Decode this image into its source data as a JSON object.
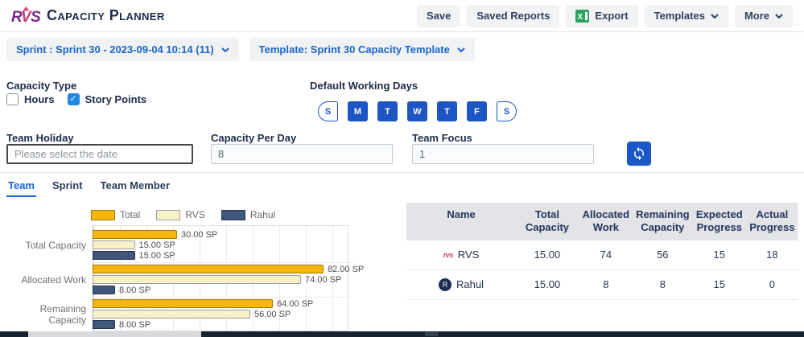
{
  "header": {
    "logo_text": "RVS",
    "title": "Capacity Planner"
  },
  "toolbar": {
    "save": "Save",
    "saved_reports": "Saved Reports",
    "export": "Export",
    "templates": "Templates",
    "more": "More"
  },
  "filters": {
    "sprint_selector": "Sprint : Sprint 30 - 2023-09-04 10:14 (11)",
    "template_selector": "Template: Sprint 30 Capacity Template"
  },
  "capacity_type": {
    "label": "Capacity Type",
    "options": [
      {
        "label": "Hours",
        "checked": false
      },
      {
        "label": "Story Points",
        "checked": true
      }
    ]
  },
  "working_days": {
    "label": "Default Working Days",
    "days": [
      {
        "label": "S",
        "active": false
      },
      {
        "label": "M",
        "active": true
      },
      {
        "label": "T",
        "active": true
      },
      {
        "label": "W",
        "active": true
      },
      {
        "label": "T",
        "active": true
      },
      {
        "label": "F",
        "active": true
      },
      {
        "label": "S",
        "active": false
      }
    ]
  },
  "inputs": {
    "team_holiday": {
      "label": "Team Holiday",
      "placeholder": "Please select the date",
      "value": ""
    },
    "capacity_per_day": {
      "label": "Capacity Per Day",
      "value": "8"
    },
    "team_focus": {
      "label": "Team Focus",
      "value": "1"
    }
  },
  "tabs": [
    {
      "label": "Team",
      "active": true
    },
    {
      "label": "Sprint",
      "active": false
    },
    {
      "label": "Team Member",
      "active": false
    }
  ],
  "chart_data": {
    "type": "bar",
    "orientation": "horizontal",
    "unit": "SP",
    "categories": [
      "Total Capacity",
      "Allocated Work",
      "Remaining Capacity"
    ],
    "series": [
      {
        "name": "Total",
        "color": "#F5B60D",
        "border": "#9E7A06",
        "values": [
          30,
          82,
          64
        ],
        "labels": [
          "30.00 SP",
          "82.00 SP",
          "64.00 SP"
        ]
      },
      {
        "name": "RVS",
        "color": "#FAF1C6",
        "border": "#9AA0A6",
        "values": [
          15,
          74,
          56
        ],
        "labels": [
          "15.00 SP",
          "74.00 SP",
          "56.00 SP"
        ]
      },
      {
        "name": "Rahul",
        "color": "#40567B",
        "border": "#22334E",
        "values": [
          15,
          8,
          8
        ],
        "labels": [
          "15.00 SP",
          "8.00 SP",
          "8.00 SP"
        ]
      }
    ],
    "xlim": [
      0,
      90
    ],
    "gridline_interval": 10,
    "grid": true,
    "legend_position": "top"
  },
  "table": {
    "columns": [
      "Name",
      "Total Capacity",
      "Allocated Work",
      "Remaining Capacity",
      "Expected Progress",
      "Actual Progress"
    ],
    "fields": [
      "name",
      "total_capacity",
      "allocated_work",
      "remaining_capacity",
      "expected_progress",
      "actual_progress"
    ],
    "rows": [
      {
        "name": "RVS",
        "icon": {
          "type": "rvs-logo",
          "text": "rvs"
        },
        "total_capacity": "15.00",
        "allocated_work": "74",
        "remaining_capacity": "56",
        "expected_progress": "15",
        "actual_progress": "18"
      },
      {
        "name": "Rahul",
        "icon": {
          "type": "avatar",
          "text": "R"
        },
        "total_capacity": "15.00",
        "allocated_work": "8",
        "remaining_capacity": "8",
        "expected_progress": "15",
        "actual_progress": "0"
      }
    ]
  },
  "colors": {
    "accent_blue": "#1D55C4",
    "chip_text_blue": "#1A66C9",
    "tab_active_blue": "#1766D8",
    "checkbox_blue": "#1E88E5",
    "navy_text": "#1C2B4A",
    "bar_total": "#F5B60D",
    "bar_rvs": "#FAF1C6",
    "bar_rahul": "#40567B",
    "excel_green": "#2AA15C",
    "table_header_bg": "#E3E4E7"
  }
}
